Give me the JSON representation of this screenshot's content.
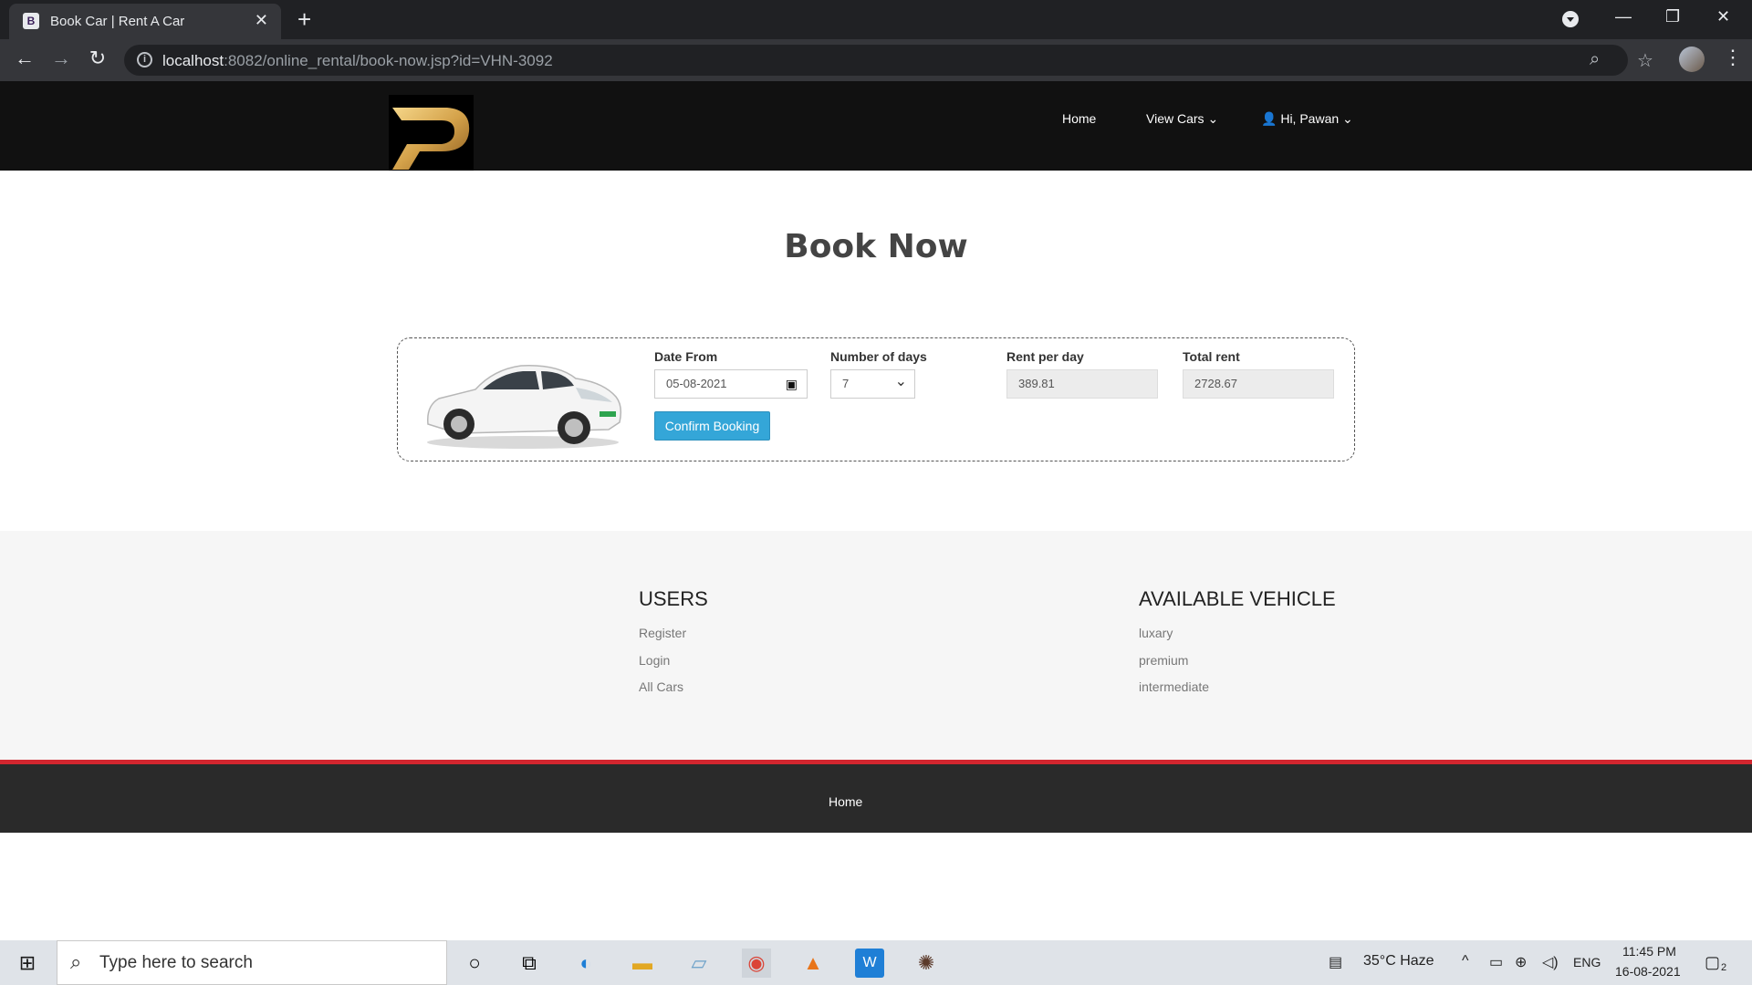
{
  "browser": {
    "tab_title": "Book Car | Rent A Car",
    "tab_favicon": "B",
    "url_host": "localhost",
    "url_rest": ":8082/online_rental/book-now.jsp?id=VHN-3092"
  },
  "nav": {
    "home": "Home",
    "view_cars": "View Cars",
    "user": "Hi, Pawan"
  },
  "page": {
    "title": "Book Now"
  },
  "booking": {
    "date_from_label": "Date From",
    "date_from_value": "05-08-2021",
    "days_label": "Number of days",
    "days_value": "7",
    "rent_label": "Rent per day",
    "rent_value": "389.81",
    "total_label": "Total rent",
    "total_value": "2728.67",
    "confirm_label": "Confirm Booking"
  },
  "footer": {
    "users_heading": "USERS",
    "users_links": [
      "Register",
      "Login",
      "All Cars"
    ],
    "vehicle_heading": "AVAILABLE VEHICLE",
    "vehicle_links": [
      "luxary",
      "premium",
      "intermediate"
    ],
    "bottom_home": "Home"
  },
  "taskbar": {
    "search_placeholder": "Type here to search",
    "weather": "35°C  Haze",
    "lang": "ENG",
    "time": "11:45 PM",
    "date": "16-08-2021",
    "notifications": "2"
  },
  "colors": {
    "accent_button": "#34a6d8",
    "footer_stripe": "#d2262f"
  }
}
